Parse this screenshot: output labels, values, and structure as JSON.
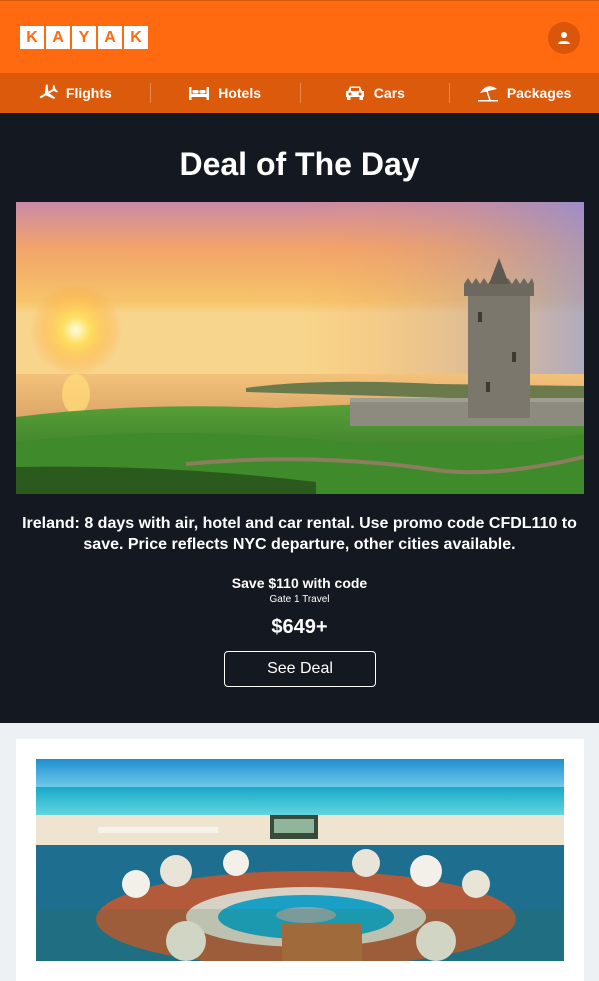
{
  "header": {
    "logo_letters": [
      "K",
      "A",
      "Y",
      "A",
      "K"
    ],
    "avatar_icon": "user-icon",
    "brand_color": "#ff690f"
  },
  "nav": {
    "items": [
      {
        "label": "Flights",
        "icon": "plane-icon"
      },
      {
        "label": "Hotels",
        "icon": "bed-icon"
      },
      {
        "label": "Cars",
        "icon": "car-icon"
      },
      {
        "label": "Packages",
        "icon": "beach-umbrella-icon"
      }
    ]
  },
  "deal": {
    "title": "Deal of The Day",
    "description": "Ireland: 8 days with air, hotel and car rental. Use promo code CFDL110 to save. Price reflects NYC departure, other cities available.",
    "save_text": "Save $110 with code",
    "provider": "Gate 1 Travel",
    "price": "$649+",
    "button_label": "See Deal"
  }
}
